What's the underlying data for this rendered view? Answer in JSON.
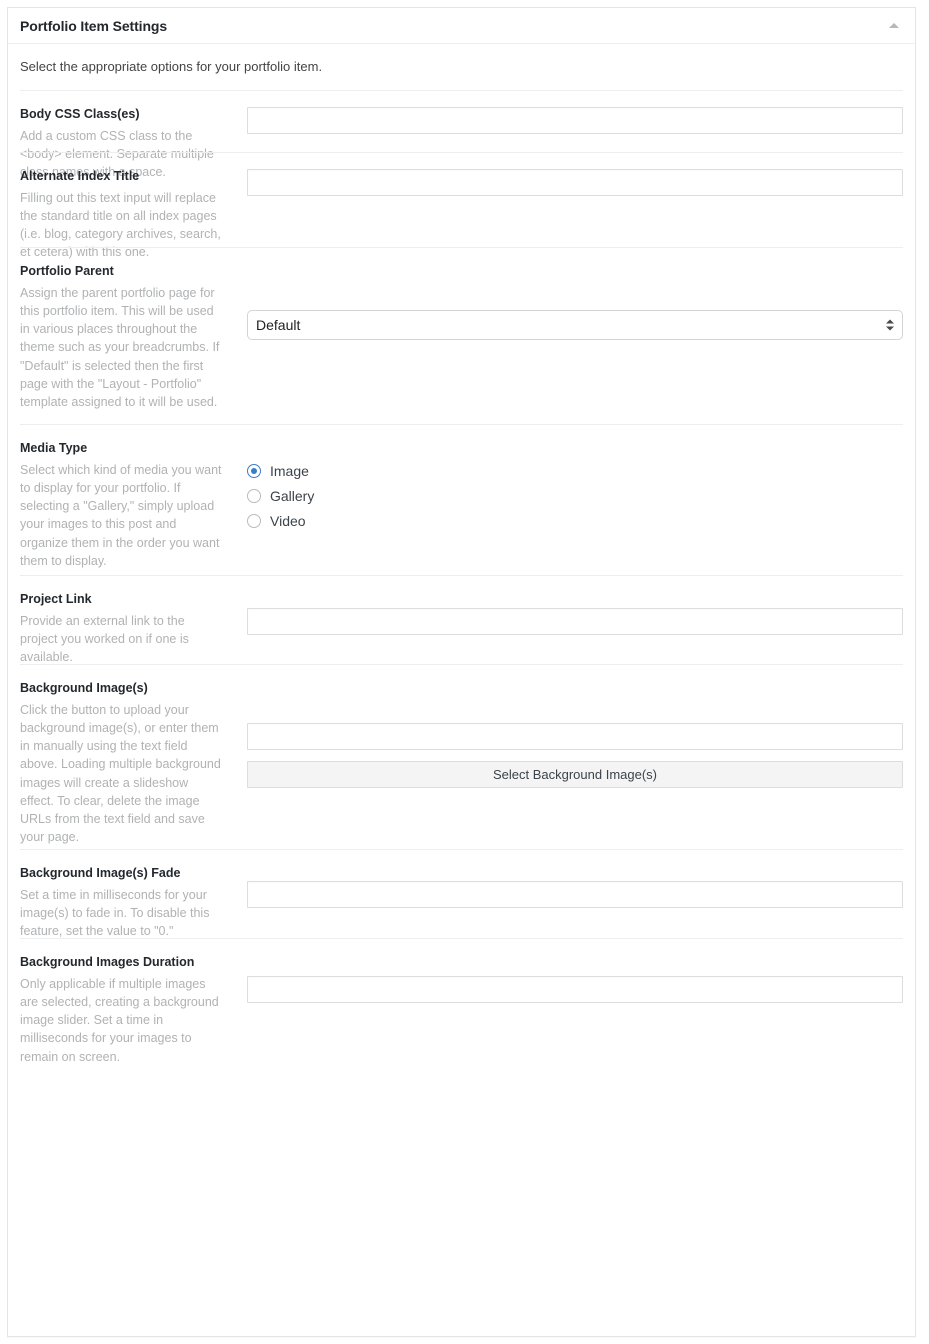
{
  "panel": {
    "title": "Portfolio Item Settings",
    "toggle_icon": "caret-up-icon",
    "intro": "Select the appropriate options for your portfolio item."
  },
  "fields": [
    {
      "title": "Body CSS Class(es)",
      "description": "Add a custom CSS class to the <body> element. Separate multiple class names with a space.",
      "control": "text",
      "value": "",
      "placeholder": ""
    },
    {
      "title": "Alternate Index Title",
      "description": "Filling out this text input will replace the standard title on all index pages (i.e. blog, category archives, search, et cetera) with this one.",
      "control": "text",
      "value": "",
      "placeholder": ""
    },
    {
      "title": "Portfolio Parent",
      "description": "Assign the parent portfolio page for this portfolio item. This will be used in various places throughout the theme such as your breadcrumbs. If \"Default\" is selected then the first page with the \"Layout - Portfolio\" template assigned to it will be used.",
      "control": "select",
      "value": "Default",
      "options": [
        "Default"
      ]
    },
    {
      "title": "Media Type",
      "description": "Select which kind of media you want to display for your portfolio. If selecting a \"Gallery,\" simply upload your images to this post and organize them in the order you want them to display.",
      "control": "radio",
      "options": [
        {
          "label": "Image",
          "checked": true
        },
        {
          "label": "Gallery",
          "checked": false
        },
        {
          "label": "Video",
          "checked": false
        }
      ]
    },
    {
      "title": "Project Link",
      "description": "Provide an external link to the project you worked on if one is available.",
      "control": "text",
      "value": "",
      "placeholder": ""
    },
    {
      "title": "Background Image(s)",
      "description": "Click the button to upload your background image(s), or enter them in manually using the text field above. Loading multiple background images will create a slideshow effect. To clear, delete the image URLs from the text field and save your page.",
      "control": "text-with-button",
      "value": "",
      "placeholder": "",
      "button_label": "Select Background Image(s)"
    },
    {
      "title": "Background Image(s) Fade",
      "description": "Set a time in milliseconds for your image(s) to fade in. To disable this feature, set the value to \"0.\"",
      "control": "text",
      "value": "",
      "placeholder": ""
    },
    {
      "title": "Background Images Duration",
      "description": "Only applicable if multiple images are selected, creating a background image slider. Set a time in milliseconds for your images to remain on screen.",
      "control": "text",
      "value": "",
      "placeholder": ""
    }
  ],
  "colors": {
    "accent": "#3a7ec8",
    "title_text": "#23282d",
    "desc_text": "#b0b2b4",
    "border": "#e5e5e5",
    "divider": "#eeeeee",
    "button_bg": "#f4f4f4"
  }
}
